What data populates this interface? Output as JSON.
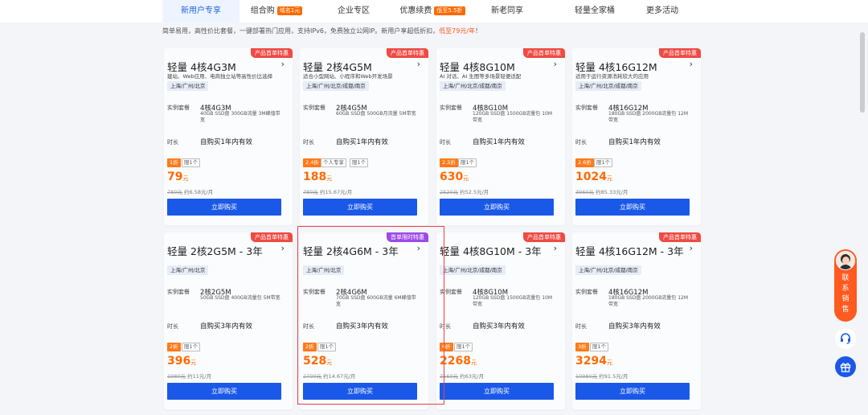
{
  "tabs": [
    {
      "label": "新用户专享",
      "badge": "",
      "active": true
    },
    {
      "label": "组合购",
      "badge": "域名1元",
      "active": false
    },
    {
      "label": "企业专区",
      "badge": "",
      "active": false
    },
    {
      "label": "优惠续费",
      "badge": "低至5.5折",
      "active": false
    },
    {
      "label": "新老同享",
      "badge": "",
      "active": false
    },
    {
      "label": "轻量全家桶",
      "badge": "",
      "active": false
    },
    {
      "label": "更多活动",
      "badge": "",
      "active": false
    }
  ],
  "description": {
    "text": "简单易用，高性价比套餐，一键部署热门应用，支持IPv6，免费独立公网IP。新用户享超低折扣，",
    "highlight": "低至79元/年",
    "suffix": "！"
  },
  "labels": {
    "plan": "实例套餐",
    "duration": "时长",
    "buy": "立即购买",
    "limit": "限1个"
  },
  "cards": [
    {
      "corner": "产品首单特惠",
      "corner_style": "red",
      "name": "轻量 4核4G3M",
      "scene": "建站、Web应用、电商独立站等高性价比选择",
      "region": "上海/广州/北京",
      "plan": "4核4G3M",
      "spec": "40GB SSD盘 300GB流量 3M峰值带宽",
      "duration": "自购买1年内有效",
      "discount": "1折",
      "extra_tag": "",
      "price": "79",
      "unit": "元",
      "original": "780元",
      "monthly": "约6.58元/月"
    },
    {
      "corner": "产品首单特惠",
      "corner_style": "red",
      "name": "轻量 2核4G5M",
      "scene": "适合小型网站、小程序和Web开发场景",
      "region": "上海/广州/北京/成都/南京",
      "plan": "2核4G5M",
      "spec": "60GB SSD盘 500GB月流量 5M带宽",
      "duration": "自购买1年内有效",
      "discount": "2.4折",
      "extra_tag": "个人专享",
      "price": "188",
      "unit": "元",
      "original": "780元",
      "monthly": "约15.67元/月"
    },
    {
      "corner": "产品首单特惠",
      "corner_style": "red",
      "name": "轻量 4核8G10M",
      "scene": "AI 对话、AI 生图等多场景轻便适配",
      "region": "上海/广州/北京/成都/南京",
      "plan": "4核8G10M",
      "spec": "120GB SSD盘 1500GB流量包 10M带宽",
      "duration": "自购买1年内有效",
      "discount": "2.5折",
      "extra_tag": "",
      "price": "630",
      "unit": "元",
      "original": "2520元",
      "monthly": "约52.5元/月"
    },
    {
      "corner": "产品首单特惠",
      "corner_style": "red",
      "name": "轻量 4核16G12M",
      "scene": "适用于运行资源消耗较大的应用",
      "region": "上海/广州/北京/成都/南京",
      "plan": "4核16G12M",
      "spec": "180GB SSD盘 2000GB流量包 12M带宽",
      "duration": "自购买1年内有效",
      "discount": "2.6折",
      "extra_tag": "",
      "price": "1024",
      "unit": "元",
      "original": "3960元",
      "monthly": "约85.33元/月"
    },
    {
      "corner": "产品首单特惠",
      "corner_style": "red",
      "name": "轻量 2核2G5M - 3年",
      "scene": "",
      "region": "上海/广州/北京",
      "plan": "2核2G5M",
      "spec": "50GB SSD盘 400GB流量包 5M带宽",
      "duration": "自购买3年内有效",
      "discount": "2折",
      "extra_tag": "",
      "price": "396",
      "unit": "元",
      "original": "1980元",
      "monthly": "约11元/月"
    },
    {
      "corner": "首单限时特惠",
      "corner_style": "purple",
      "name": "轻量 2核4G6M - 3年",
      "scene": "",
      "region": "上海/广州/北京",
      "plan": "2核4G6M",
      "spec": "70GB SSD盘 600GB流量 6M峰值带宽",
      "duration": "自购买3年内有效",
      "discount": "2折",
      "extra_tag": "",
      "price": "528",
      "unit": "元",
      "original": "2700元",
      "monthly": "约14.67元/月"
    },
    {
      "corner": "产品首单特惠",
      "corner_style": "red",
      "name": "轻量 4核8G10M - 3年",
      "scene": "",
      "region": "上海/广州/北京/成都/南京",
      "plan": "4核8G10M",
      "spec": "120GB SSD盘 1500GB流量包 10M带宽",
      "duration": "自购买3年内有效",
      "discount": "6折",
      "extra_tag": "",
      "price": "2268",
      "unit": "元",
      "original": "3560元",
      "monthly": "约63元/月"
    },
    {
      "corner": "产品首单特惠",
      "corner_style": "red",
      "name": "轻量 4核16G12M - 3年",
      "scene": "",
      "region": "上海/广州/北京/成都/南京",
      "plan": "4核16G12M",
      "spec": "180GB SSD盘 2000GB流量包 12M带宽",
      "duration": "自购买3年内有效",
      "discount": "3折",
      "extra_tag": "",
      "price": "3294",
      "unit": "元",
      "original": "10980元",
      "monthly": "约91.5元/月"
    }
  ],
  "float": {
    "sales_label": "联系销售",
    "support_icon": "headset-icon",
    "gift_icon": "gift-icon"
  },
  "colors": {
    "primary": "#1a58e8",
    "price": "#ff6a00",
    "corner_red": "#f04a43",
    "corner_purple": "#9d4ae8",
    "highlight_box": "#e8424a"
  }
}
